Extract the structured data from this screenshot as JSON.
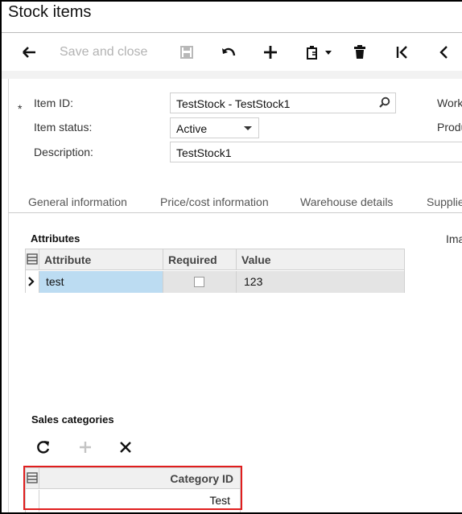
{
  "window": {
    "title": "Stock items"
  },
  "toolbar": {
    "back_icon": "arrow-left-icon",
    "save_close_label": "Save and close",
    "save_icon": "floppy-icon",
    "undo_icon": "undo-icon",
    "add_icon": "plus-icon",
    "copy_paste_icon": "clipboard-icon",
    "delete_icon": "trash-icon",
    "first_icon": "first-page-icon",
    "prev_icon": "chevron-left-icon"
  },
  "form": {
    "item_id": {
      "required_mark": "*",
      "label": "Item ID:",
      "value": "TestStock - TestStock1"
    },
    "item_status": {
      "label": "Item status:",
      "value": "Active"
    },
    "description": {
      "label": "Description:",
      "value": "TestStock1"
    },
    "right_labels": [
      "Work",
      "Produ"
    ]
  },
  "tabs": [
    "General information",
    "Price/cost information",
    "Warehouse details",
    "Supplie"
  ],
  "attributes": {
    "title": "Attributes",
    "columns": [
      "Attribute",
      "Required",
      "Value"
    ],
    "rows": [
      {
        "attribute": "test",
        "required": false,
        "value": "123"
      }
    ],
    "right_label": "Ima"
  },
  "sales_categories": {
    "title": "Sales categories",
    "toolbar": [
      "refresh-icon",
      "plus-icon",
      "close-icon"
    ],
    "column": "Category ID",
    "rows": [
      {
        "category_id": "Test"
      }
    ]
  },
  "colors": {
    "accent_selected": "#bcdcf2",
    "highlight": "#e01e1e",
    "disabled": "#b3b3b3"
  }
}
